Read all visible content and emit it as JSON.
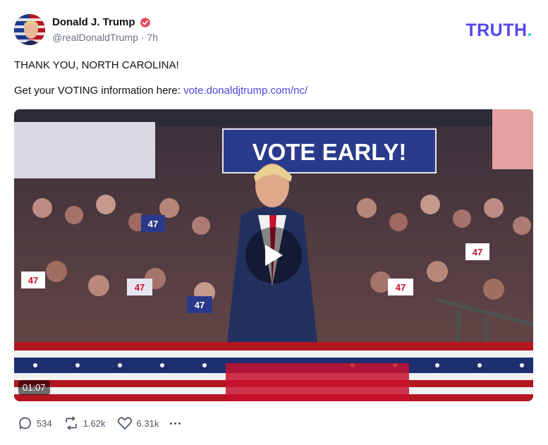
{
  "post": {
    "author_name": "Donald J. Trump",
    "handle": "@realDonaldTrump",
    "separator": "·",
    "time": "7h",
    "line1": "THANK YOU, NORTH CAROLINA!",
    "line2_prefix": "Get your VOTING information here: ",
    "line2_link": "vote.donaldjtrump.com/nc/"
  },
  "brand": {
    "logo_main": "TRUTH",
    "logo_dot": "."
  },
  "video": {
    "duration": "01:07",
    "banner_text": "VOTE EARLY!",
    "sign_text": "47"
  },
  "actions": {
    "replies": "534",
    "retruths": "1.62k",
    "likes": "6.31k"
  },
  "colors": {
    "accent": "#5448ee",
    "accent_dot": "#2bd1b6",
    "link": "#4f44e0",
    "verified": "#e8475f"
  },
  "icons": [
    "verified-badge-icon",
    "play-icon",
    "reply-icon",
    "retruth-icon",
    "like-icon",
    "more-icon"
  ]
}
